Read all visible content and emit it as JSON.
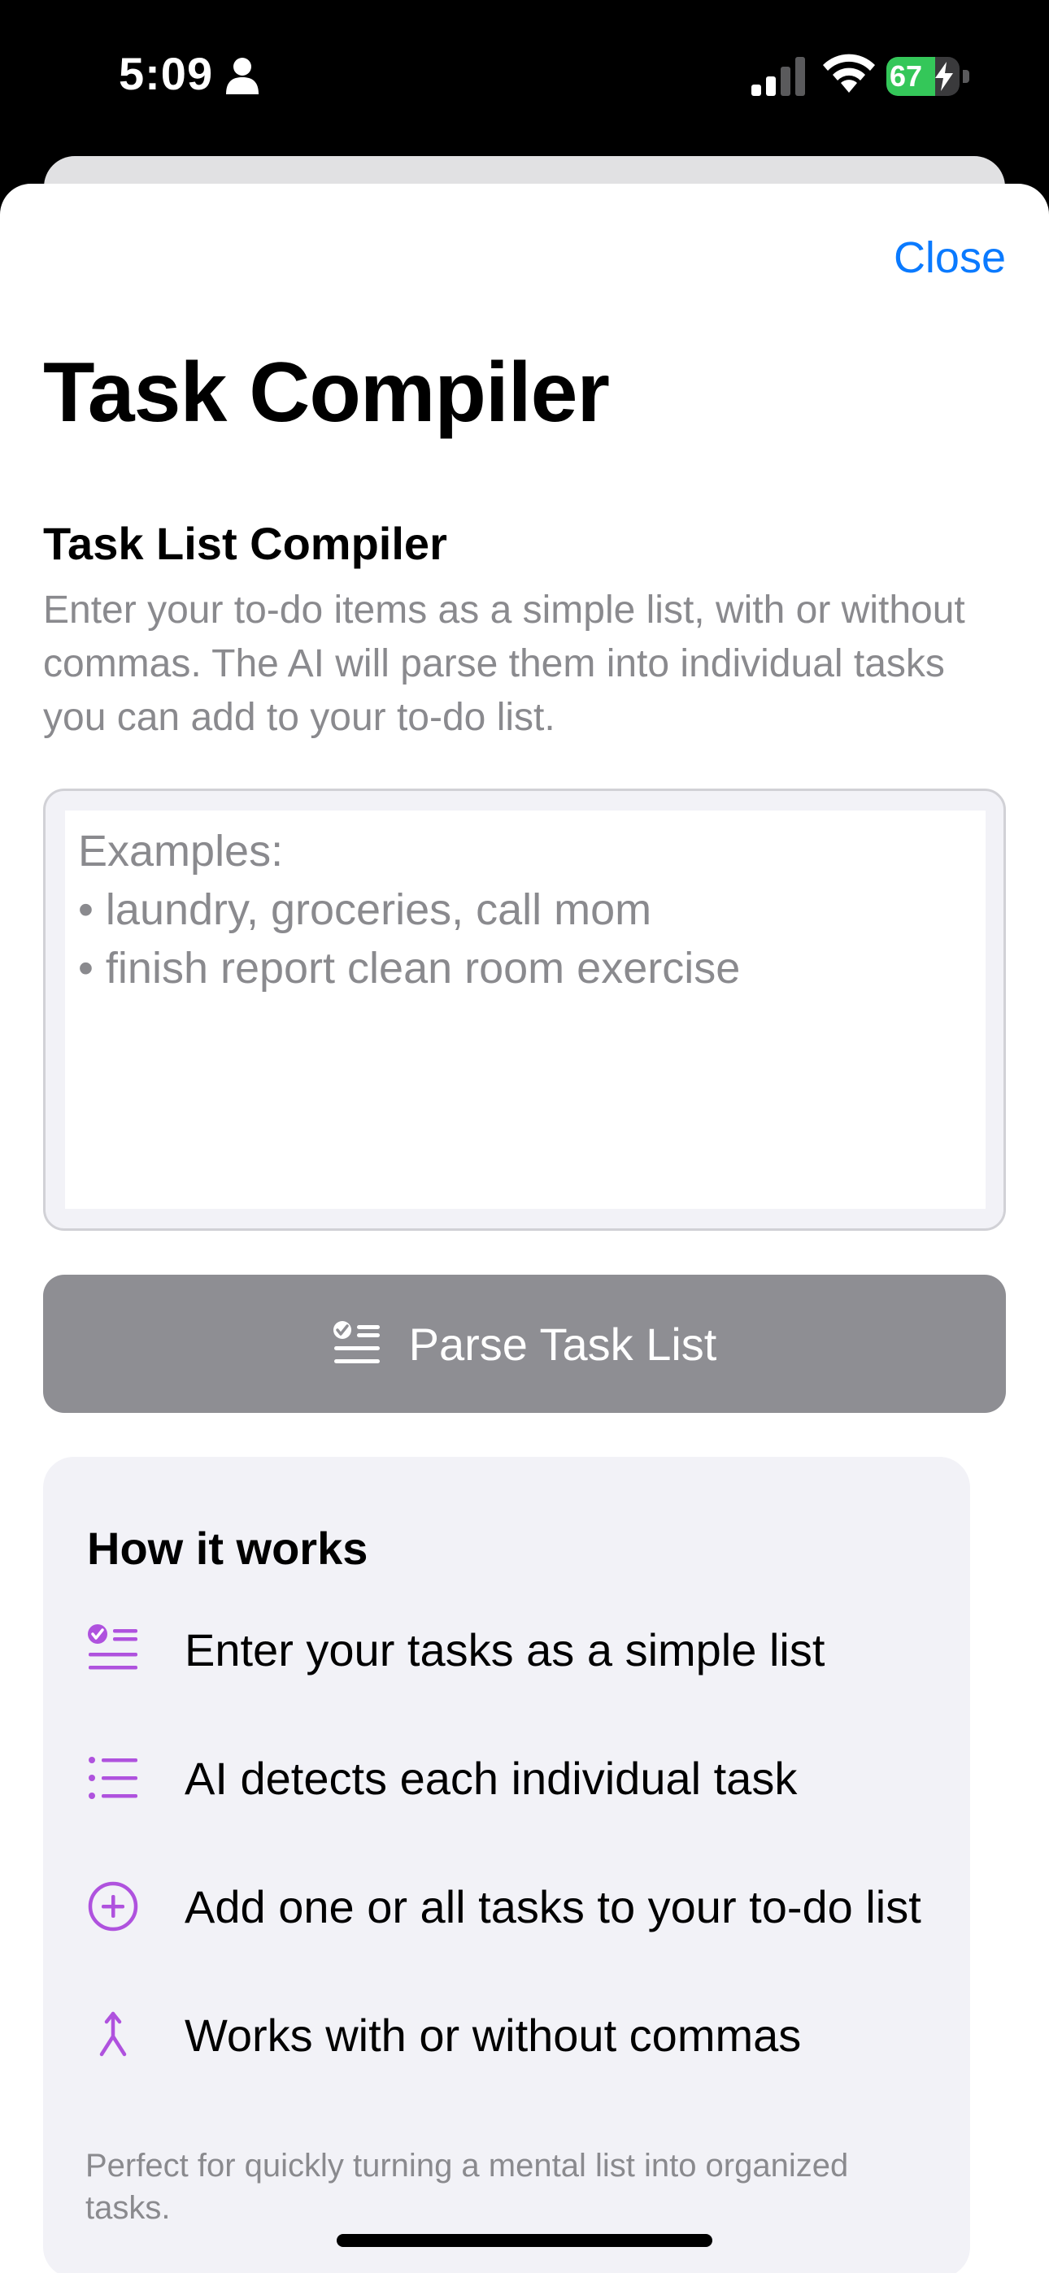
{
  "status_bar": {
    "time": "5:09",
    "battery_level": 67,
    "battery_text": "67",
    "icons": [
      "person-icon",
      "cellular-signal-icon",
      "wifi-icon",
      "battery-charging-icon"
    ]
  },
  "sheet": {
    "close_label": "Close",
    "title": "Task Compiler"
  },
  "compiler": {
    "section_title": "Task List Compiler",
    "description": "Enter your to-do items as a simple list, with or without commas. The AI will parse them into individual tasks you can add to your to-do list.",
    "input_value": "",
    "input_placeholder": "Examples:\n• laundry, groceries, call mom\n• finish report clean room exercise",
    "parse_button_label": "Parse Task List",
    "parse_button_icon": "checklist-icon"
  },
  "how_it_works": {
    "title": "How it works",
    "items": [
      {
        "icon": "checklist-icon",
        "label": "Enter your tasks as a simple list"
      },
      {
        "icon": "list-bullet-icon",
        "label": "AI detects each individual task"
      },
      {
        "icon": "plus-circle-icon",
        "label": "Add one or all tasks to your to-do list"
      },
      {
        "icon": "merge-arrow-icon",
        "label": "Works with or without commas"
      }
    ],
    "footer_note": "Perfect for quickly turning a mental list into organized tasks."
  },
  "colors": {
    "accent_blue": "#0a7aff",
    "accent_purple": "#af52de",
    "button_gray": "#8e8e93",
    "card_background": "#f2f2f7",
    "secondary_text": "#8a8a8e",
    "battery_green": "#34c759"
  }
}
